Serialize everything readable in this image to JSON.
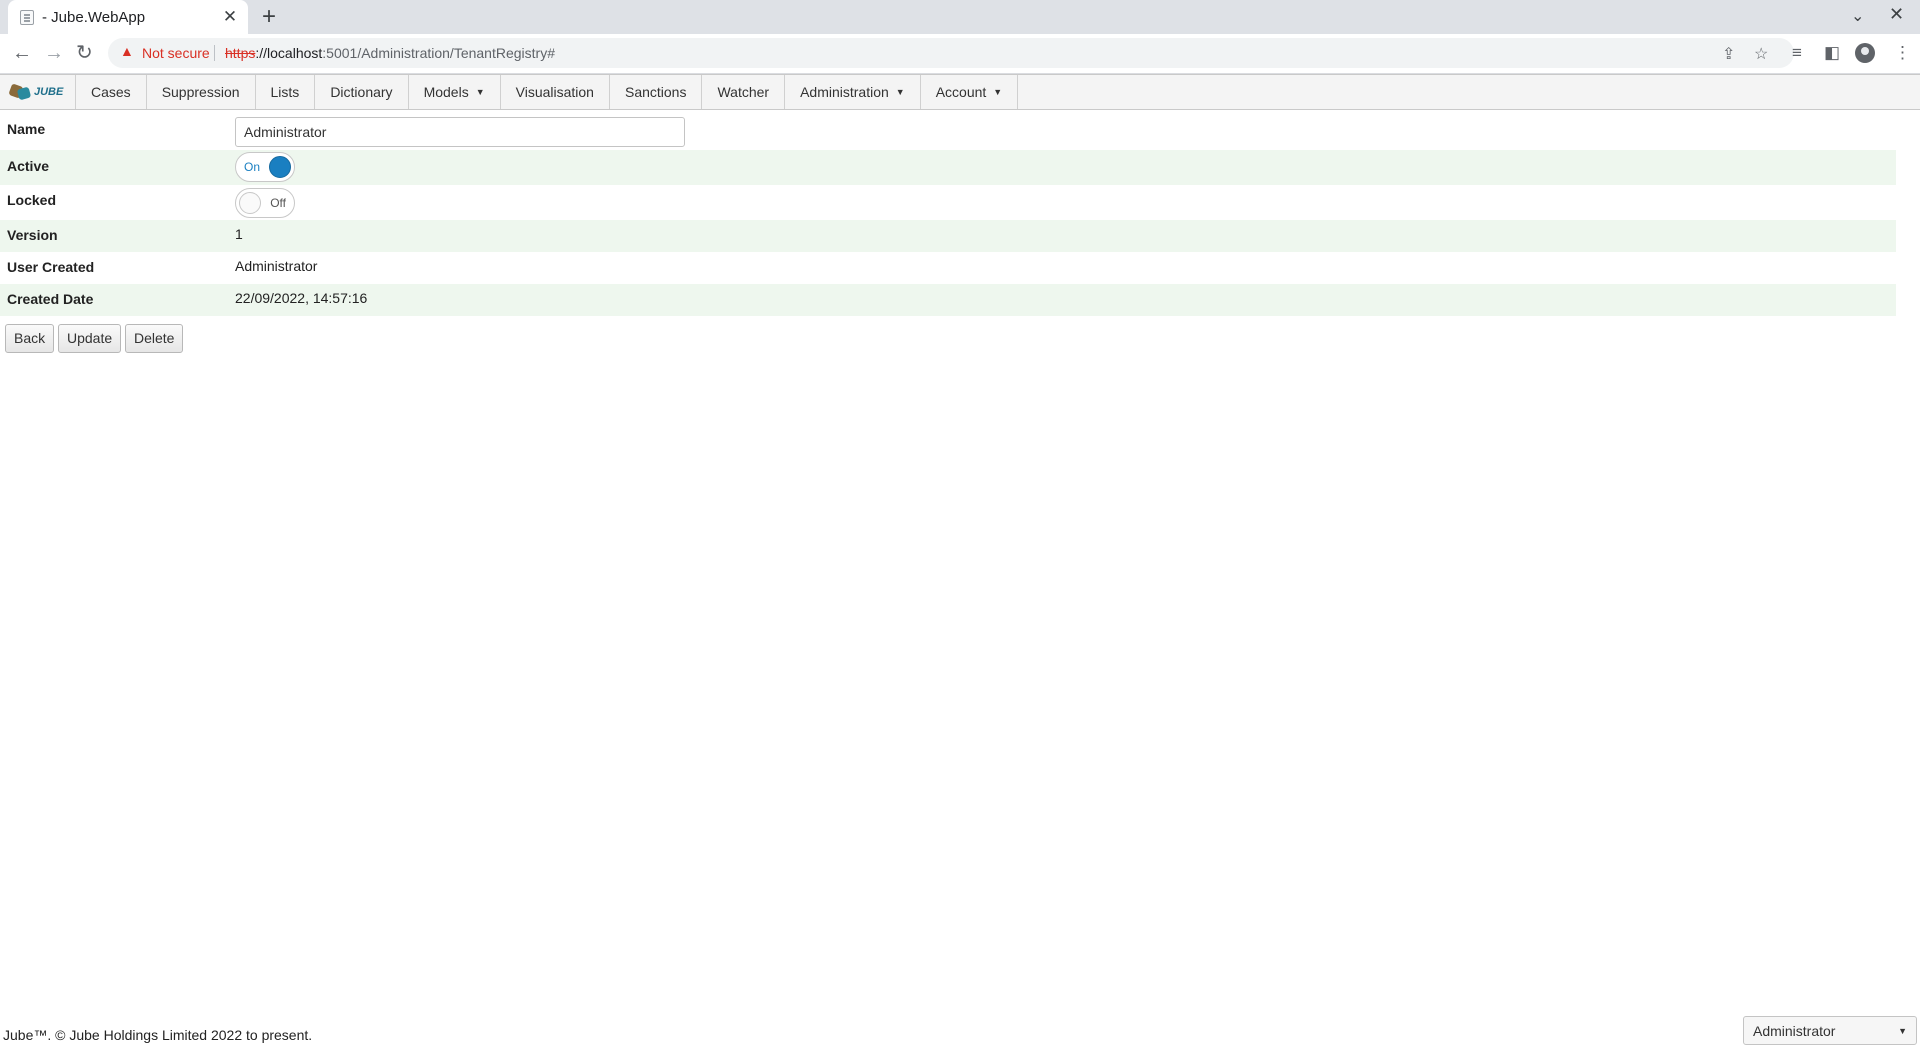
{
  "browser": {
    "tab_title": "- Jube.WebApp",
    "new_tab_glyph": "+",
    "security_label": "Not secure",
    "url_scheme": "https",
    "url_host": "://localhost",
    "url_rest": ":5001/Administration/TenantRegistry#"
  },
  "menu": {
    "logo_text": "JUBE",
    "items": [
      "Cases",
      "Suppression",
      "Lists",
      "Dictionary",
      "Models",
      "Visualisation",
      "Sanctions",
      "Watcher",
      "Administration",
      "Account"
    ],
    "dropdown_items": [
      "Models",
      "Administration",
      "Account"
    ]
  },
  "form": {
    "name_label": "Name",
    "name_value": "Administrator",
    "active_label": "Active",
    "active_state": "On",
    "active_on": true,
    "locked_label": "Locked",
    "locked_state": "Off",
    "locked_on": false,
    "version_label": "Version",
    "version_value": "1",
    "user_created_label": "User Created",
    "user_created_value": "Administrator",
    "created_date_label": "Created Date",
    "created_date_value": "22/09/2022, 14:57:16"
  },
  "buttons": {
    "back": "Back",
    "update": "Update",
    "delete": "Delete"
  },
  "footer": {
    "copyright": "Jube™. © Jube Holdings Limited 2022 to present.",
    "user_select_value": "Administrator"
  },
  "colors": {
    "accent": "#1a7fc1",
    "row_alt": "#eef7ee",
    "warning": "#d93025"
  }
}
